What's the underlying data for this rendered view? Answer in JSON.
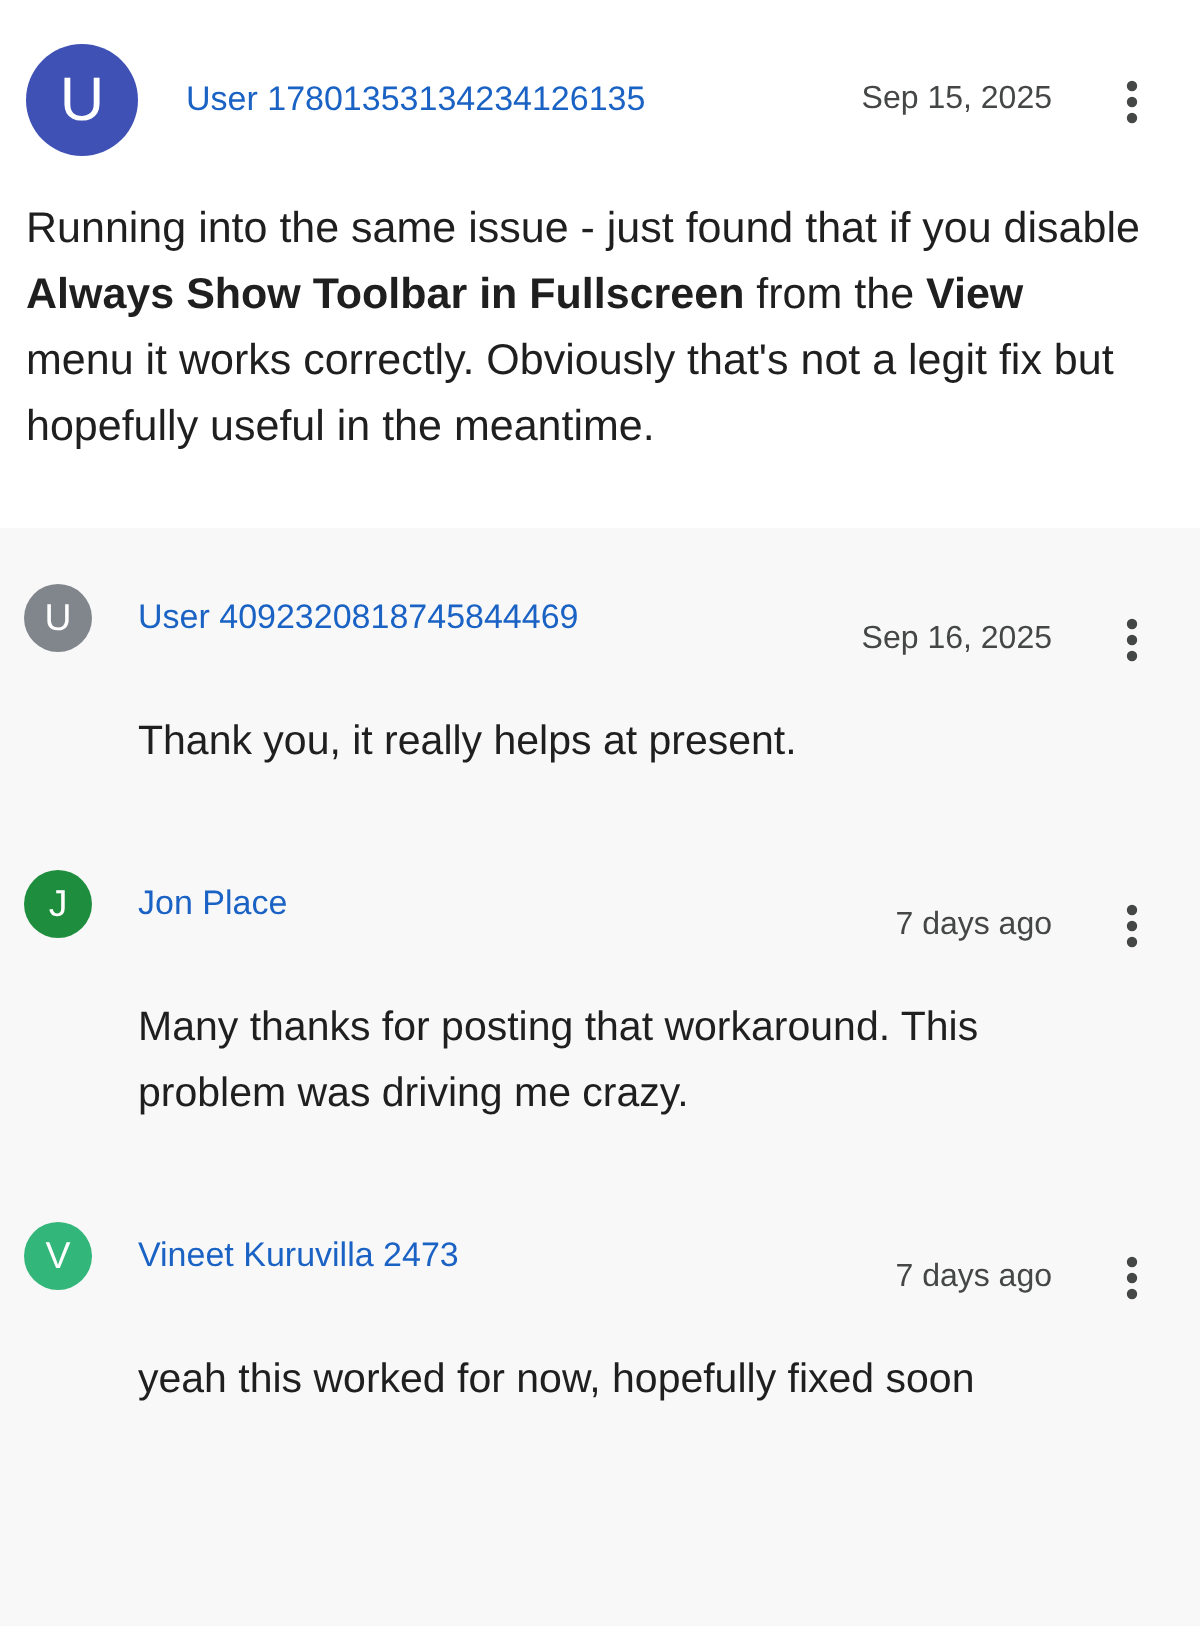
{
  "post": {
    "author": "User 17801353134234126135",
    "initial": "U",
    "color": "#3f51b5",
    "date": "Sep 15, 2025",
    "body": "Running into the same issue - just found that if you disable **Always Show Toolbar in Fullscreen** from the **View** menu it works correctly. Obviously that's not a legit fix but hopefully useful in the meantime."
  },
  "replies": [
    {
      "author": "User 4092320818745844469",
      "initial": "U",
      "color": "#80868b",
      "date": "Sep 16, 2025",
      "body": "Thank you, it really helps at present."
    },
    {
      "author": "Jon Place",
      "initial": "J",
      "color": "#1e8e3e",
      "date": "7 days ago",
      "body": "Many thanks for posting that workaround.  This problem was driving me crazy."
    },
    {
      "author": "Vineet Kuruvilla 2473",
      "initial": "V",
      "color": "#33b679",
      "date": "7 days ago",
      "body": "yeah this worked for now, hopefully fixed soon"
    }
  ]
}
